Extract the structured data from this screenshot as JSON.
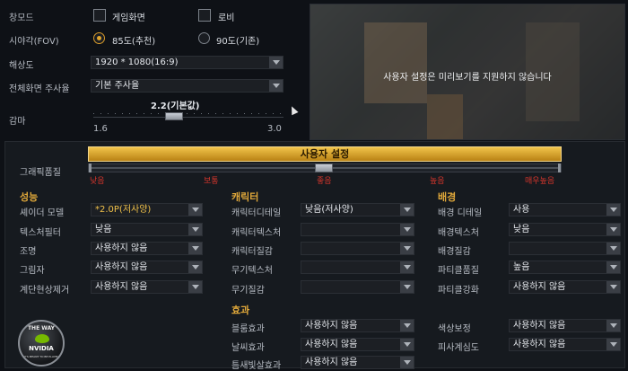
{
  "top": {
    "window_mode": {
      "label": "창모드",
      "opt1": "게임화면",
      "opt2": "로비"
    },
    "fov": {
      "label": "시야각(FOV)",
      "opt1": "85도(추천)",
      "opt2": "90도(기존)"
    },
    "resolution": {
      "label": "해상도",
      "value": "1920 * 1080(16:9)"
    },
    "refresh": {
      "label": "전체화면 주사율",
      "value": "기본 주사율"
    },
    "gamma": {
      "label": "감마",
      "value_label": "2.2(기본값)",
      "min": "1.6",
      "max": "3.0",
      "value": 2.2
    }
  },
  "preview": {
    "message": "사용자 설정은 미리보기를 지원하지 않습니다"
  },
  "quality": {
    "header": "사용자 설정",
    "label": "그래픽품질",
    "levels": [
      "낮음",
      "보통",
      "좋음",
      "높음",
      "매우높음"
    ]
  },
  "perf": {
    "title": "성능",
    "rows": [
      {
        "label": "셰이더 모델",
        "value": "*2.0P(저사양)"
      },
      {
        "label": "텍스처필터",
        "value": "낮음"
      },
      {
        "label": "조명",
        "value": "사용하지 않음"
      },
      {
        "label": "그림자",
        "value": "사용하지 않음"
      },
      {
        "label": "계단현상제거",
        "value": "사용하지 않음"
      }
    ]
  },
  "char": {
    "title": "캐릭터",
    "rows": [
      {
        "label": "캐릭터디테일",
        "value": "낮음(저사양)"
      },
      {
        "label": "캐릭터텍스처",
        "value": ""
      },
      {
        "label": "캐릭터질감",
        "value": ""
      },
      {
        "label": "무기텍스처",
        "value": ""
      },
      {
        "label": "무기질감",
        "value": ""
      }
    ]
  },
  "bg": {
    "title": "배경",
    "rows": [
      {
        "label": "배경 디테일",
        "value": "사용"
      },
      {
        "label": "배경텍스처",
        "value": "낮음"
      },
      {
        "label": "배경질감",
        "value": ""
      },
      {
        "label": "파티클품질",
        "value": "높음"
      },
      {
        "label": "파티클강화",
        "value": "사용하지 않음"
      }
    ]
  },
  "effects": {
    "title": "효과",
    "left": [
      {
        "label": "블룸효과",
        "value": "사용하지 않음"
      },
      {
        "label": "날씨효과",
        "value": "사용하지 않음"
      },
      {
        "label": "틈새빛살효과",
        "value": "사용하지 않음"
      }
    ],
    "right": [
      {
        "label": "색상보정",
        "value": "사용하지 않음"
      },
      {
        "label": "피사계심도",
        "value": "사용하지 않음"
      }
    ]
  },
  "logo": {
    "top": "THE WAY",
    "brand": "NVIDIA",
    "bottom": "IT'S MEANT TO BE PLAYED"
  }
}
